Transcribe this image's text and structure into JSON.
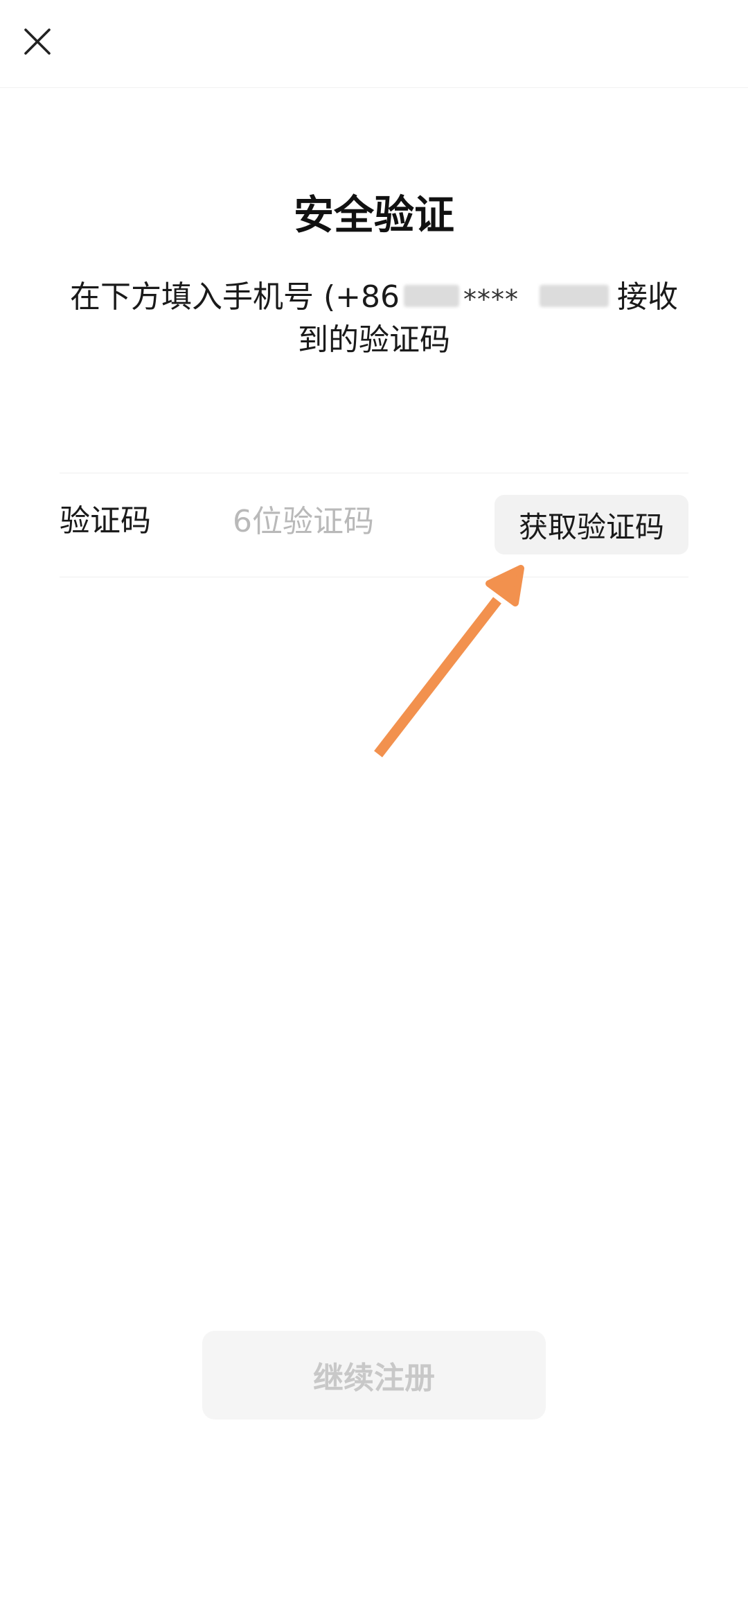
{
  "header": {
    "close_icon": "close-icon"
  },
  "page": {
    "title": "安全验证",
    "subtitle_prefix": "在下方填入手机号 (+86",
    "masked_stars": "****",
    "subtitle_suffix": "接收到的验证码"
  },
  "code_row": {
    "label": "验证码",
    "placeholder": "6位验证码",
    "value": "",
    "get_code_label": "获取验证码"
  },
  "annotation": {
    "arrow_color": "#F2914E",
    "arrow_icon": "arrow-up-right-icon"
  },
  "footer": {
    "continue_label": "继续注册"
  },
  "colors": {
    "title": "#111111",
    "placeholder": "#B9B9B9",
    "button_bg": "#F2F2F2",
    "disabled_text": "#C8C8C8"
  }
}
